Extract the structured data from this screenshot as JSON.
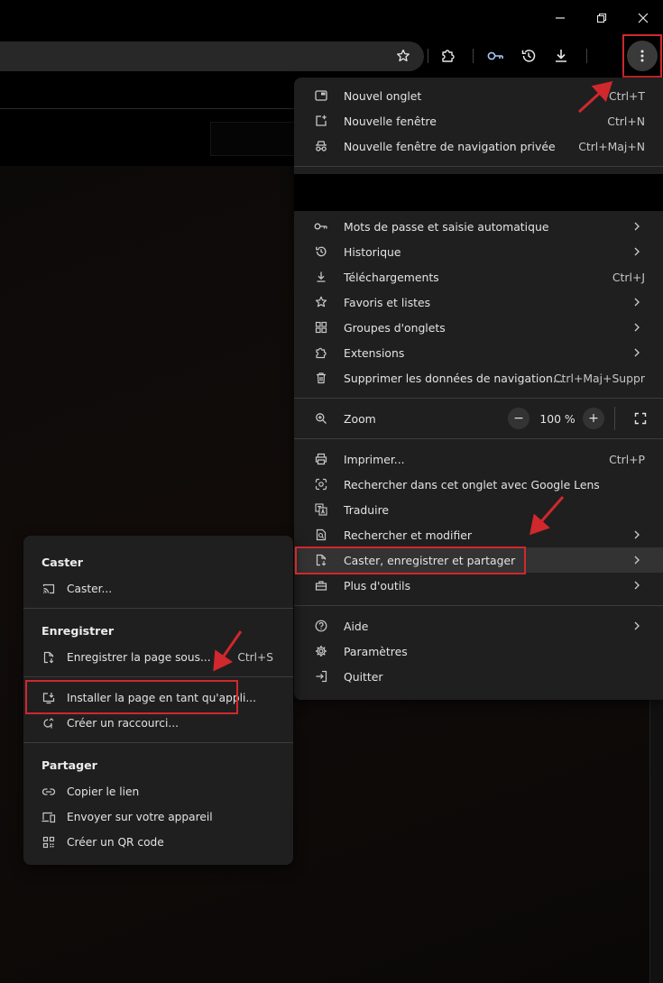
{
  "window": {
    "minimize_icon": "minimize-icon",
    "restore_icon": "restore-icon",
    "close_icon": "close-icon"
  },
  "toolbar": {
    "icons": [
      "star-icon",
      "extensions-icon",
      "password-key-icon",
      "history-icon",
      "download-icon",
      "more-vert-icon"
    ]
  },
  "colors": {
    "menu_bg": "#1f1f1f",
    "highlight": "#333333",
    "annotation_red": "#d0282d",
    "text": "#e3e3e3"
  },
  "menu": {
    "group1": [
      {
        "label": "Nouvel onglet",
        "shortcut": "Ctrl+T",
        "icon": "new-tab-icon"
      },
      {
        "label": "Nouvelle fenêtre",
        "shortcut": "Ctrl+N",
        "icon": "new-window-icon"
      },
      {
        "label": "Nouvelle fenêtre de navigation privée",
        "shortcut": "Ctrl+Maj+N",
        "icon": "incognito-icon"
      }
    ],
    "group2": [
      {
        "label": "Mots de passe et saisie automatique",
        "shortcut": "",
        "icon": "key-icon",
        "submenu": true
      },
      {
        "label": "Historique",
        "shortcut": "",
        "icon": "history-icon",
        "submenu": true
      },
      {
        "label": "Téléchargements",
        "shortcut": "Ctrl+J",
        "icon": "download-icon",
        "submenu": false
      },
      {
        "label": "Favoris et listes",
        "shortcut": "",
        "icon": "star-icon",
        "submenu": true
      },
      {
        "label": "Groupes d'onglets",
        "shortcut": "",
        "icon": "tab-groups-icon",
        "submenu": true
      },
      {
        "label": "Extensions",
        "shortcut": "",
        "icon": "extensions-icon",
        "submenu": true
      },
      {
        "label": "Supprimer les données de navigation...",
        "shortcut": "Ctrl+Maj+Suppr",
        "icon": "trash-icon",
        "submenu": false
      }
    ],
    "zoom": {
      "label": "Zoom",
      "value": "100 %",
      "minus": "−",
      "plus": "+"
    },
    "group3": [
      {
        "label": "Imprimer...",
        "shortcut": "Ctrl+P",
        "icon": "print-icon",
        "submenu": false
      },
      {
        "label": "Rechercher dans cet onglet avec Google Lens",
        "shortcut": "",
        "icon": "lens-icon",
        "submenu": false
      },
      {
        "label": "Traduire",
        "shortcut": "",
        "icon": "translate-icon",
        "submenu": false
      },
      {
        "label": "Rechercher et modifier",
        "shortcut": "",
        "icon": "find-icon",
        "submenu": true
      },
      {
        "label": "Caster, enregistrer et partager",
        "shortcut": "",
        "icon": "cast-save-share-icon",
        "submenu": true
      },
      {
        "label": "Plus d'outils",
        "shortcut": "",
        "icon": "toolbox-icon",
        "submenu": true
      }
    ],
    "group4": [
      {
        "label": "Aide",
        "shortcut": "",
        "icon": "help-icon",
        "submenu": true
      },
      {
        "label": "Paramètres",
        "shortcut": "",
        "icon": "settings-icon",
        "submenu": false
      },
      {
        "label": "Quitter",
        "shortcut": "",
        "icon": "exit-icon",
        "submenu": false
      }
    ]
  },
  "submenu": {
    "cast": {
      "heading": "Caster",
      "items": [
        {
          "label": "Caster...",
          "shortcut": "",
          "icon": "cast-icon"
        }
      ]
    },
    "save": {
      "heading": "Enregistrer",
      "items": [
        {
          "label": "Enregistrer la page sous...",
          "shortcut": "Ctrl+S",
          "icon": "save-page-icon"
        }
      ]
    },
    "install": [
      {
        "label": "Installer la page en tant qu'appli...",
        "shortcut": "",
        "icon": "install-app-icon"
      },
      {
        "label": "Créer un raccourci...",
        "shortcut": "",
        "icon": "shortcut-icon"
      }
    ],
    "share": {
      "heading": "Partager",
      "items": [
        {
          "label": "Copier le lien",
          "shortcut": "",
          "icon": "link-icon"
        },
        {
          "label": "Envoyer sur votre appareil",
          "shortcut": "",
          "icon": "send-device-icon"
        },
        {
          "label": "Créer un QR code",
          "shortcut": "",
          "icon": "qr-code-icon"
        }
      ]
    }
  }
}
